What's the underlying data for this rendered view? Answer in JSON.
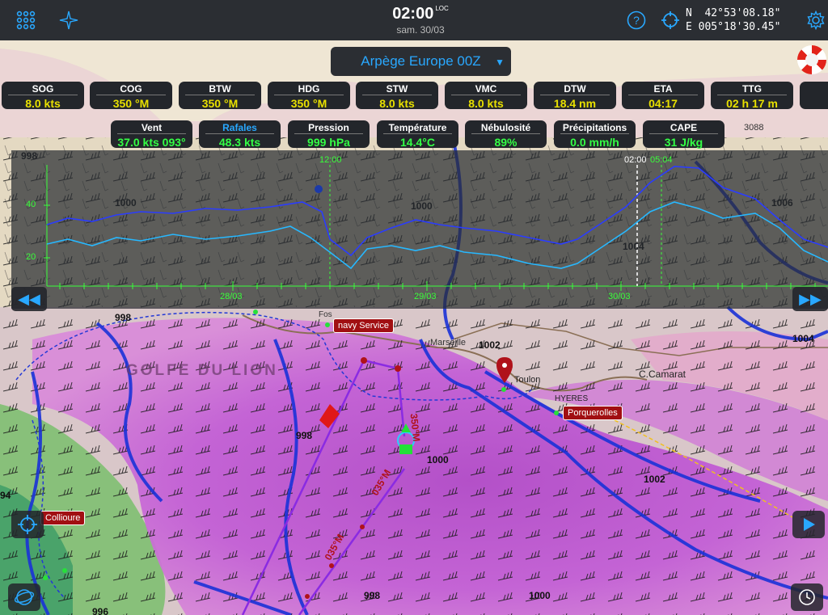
{
  "topbar": {
    "time": "02:00",
    "time_suffix": "LOC",
    "date": "sam. 30/03",
    "lat": "N  42°53'08.18\"",
    "lon": "E 005°18'30.45\""
  },
  "model": {
    "label": "Arpège Europe 00Z"
  },
  "instruments": [
    {
      "label": "SOG",
      "value": "8.0 kts"
    },
    {
      "label": "COG",
      "value": "350 °M"
    },
    {
      "label": "BTW",
      "value": "350 °M"
    },
    {
      "label": "HDG",
      "value": "350 °M"
    },
    {
      "label": "STW",
      "value": "8.0 kts"
    },
    {
      "label": "VMC",
      "value": "8.0 kts"
    },
    {
      "label": "DTW",
      "value": "18.4 nm"
    },
    {
      "label": "ETA",
      "value": "04:17"
    },
    {
      "label": "TTG",
      "value": "02 h 17 m"
    }
  ],
  "weather": [
    {
      "label": "Vent",
      "value": "37.0 kts 093°"
    },
    {
      "label": "Rafales",
      "value": "48.3 kts"
    },
    {
      "label": "Pression",
      "value": "999 hPa"
    },
    {
      "label": "Température",
      "value": "14.4°C"
    },
    {
      "label": "Nébulosité",
      "value": "89%"
    },
    {
      "label": "Précipitations",
      "value": "0.0 mm/h"
    },
    {
      "label": "CAPE",
      "value": "31 J/kg"
    }
  ],
  "graph": {
    "y_ticks": [
      "40",
      "20"
    ],
    "x_ticks": [
      "28/03",
      "29/03",
      "30/03"
    ],
    "markers": [
      "12:00",
      "02:00",
      "05:04"
    ]
  },
  "map": {
    "labels": {
      "golfe": "GOLFE DU LION",
      "marseille": "Marseille",
      "toulon": "Toulon",
      "hyeres": "HYERES",
      "camarat": "C.Camarat",
      "fos": "Fos"
    },
    "pins": {
      "navy": "navy Service",
      "porquerolles": "Porquerolles",
      "collioure": "Collioure"
    },
    "isobars": [
      "998",
      "1000",
      "1000",
      "998",
      "1002",
      "1004",
      "1006",
      "1004",
      "1002",
      "998",
      "1000",
      "998",
      "996",
      "94",
      "1000",
      "1004",
      "3088"
    ],
    "route_labels": [
      "350°M",
      "035°M",
      "035°M"
    ]
  }
}
